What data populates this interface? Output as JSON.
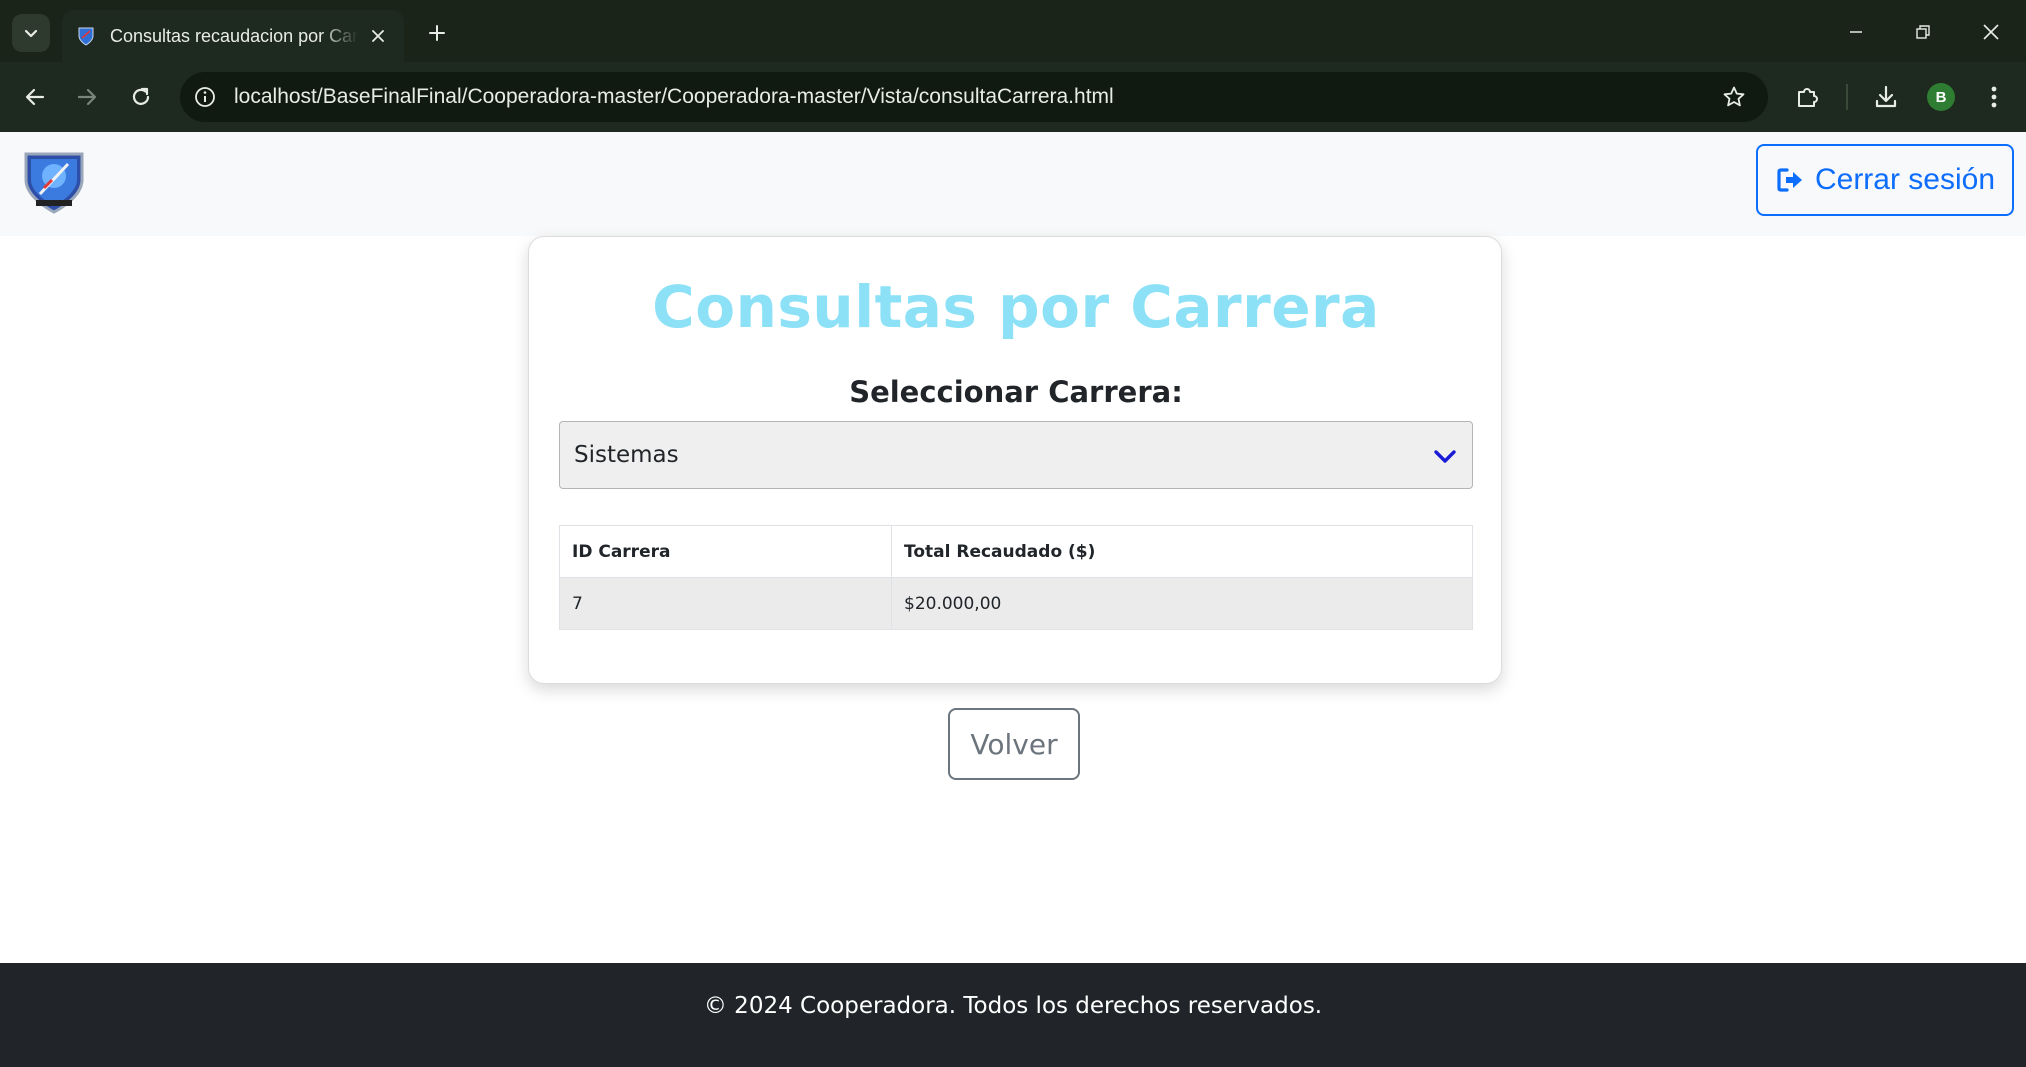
{
  "browser": {
    "tab": {
      "title": "Consultas recaudacion por Carrera"
    },
    "address_bar": {
      "url": "localhost/BaseFinalFinal/Cooperadora-master/Cooperadora-master/Vista/consultaCarrera.html"
    },
    "profile_initial": "B",
    "icons": {
      "tab_search": "chevron-down-icon",
      "favicon": "shield-icon",
      "close_tab": "close-icon",
      "new_tab": "plus-icon",
      "back": "arrow-left-icon",
      "forward": "arrow-right-icon",
      "reload": "reload-icon",
      "site_info": "info-icon",
      "bookmark": "star-icon",
      "extensions": "puzzle-icon",
      "downloads": "download-icon",
      "menu": "kebab-icon",
      "minimize": "minimize-icon",
      "restore": "restore-icon",
      "close_window": "close-icon"
    }
  },
  "navbar": {
    "logout_label": "Cerrar sesión",
    "logout_icon": "sign-out-icon"
  },
  "main": {
    "title": "Consultas por Carrera",
    "select_label": "Seleccionar Carrera:",
    "selected_career": "Sistemas",
    "table": {
      "headers": [
        "ID Carrera",
        "Total Recaudado ($)"
      ],
      "rows": [
        [
          "7",
          "$20.000,00"
        ]
      ]
    },
    "back_label": "Volver"
  },
  "footer": {
    "text": "© 2024 Cooperadora. Todos los derechos reservados."
  },
  "colors": {
    "title": "#8de1f7",
    "primary": "#0d6efd",
    "secondary": "#6c757d",
    "footer_bg": "#212529",
    "chrome_bg": "#1e2a1f"
  }
}
